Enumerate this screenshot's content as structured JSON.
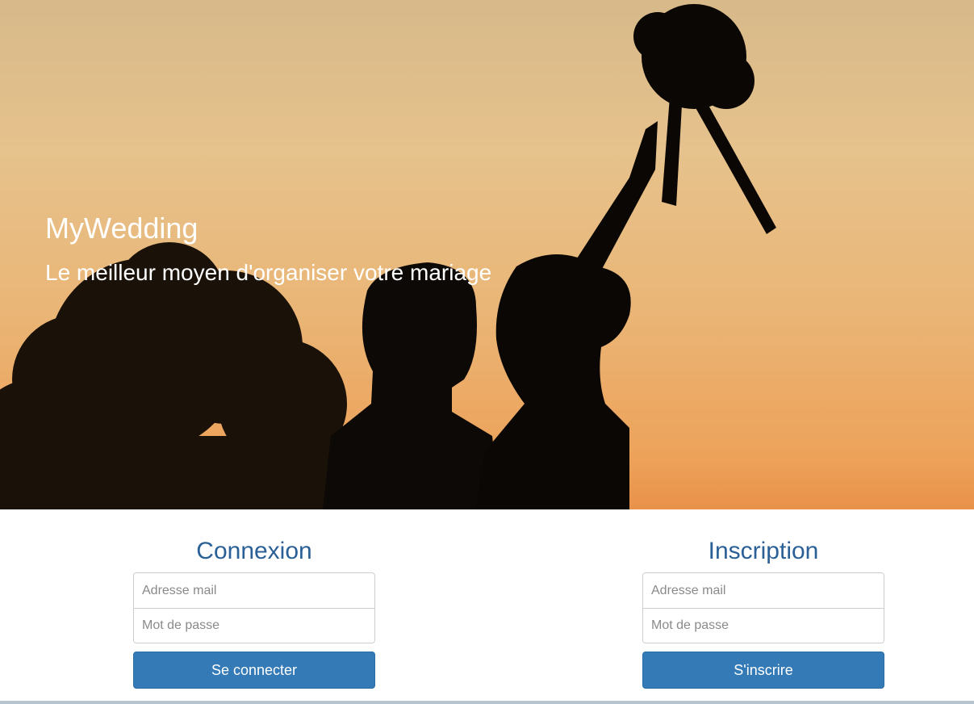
{
  "hero": {
    "title": "MyWedding",
    "tagline": "Le meilleur moyen d'organiser votre mariage"
  },
  "login": {
    "heading": "Connexion",
    "email_placeholder": "Adresse mail",
    "password_placeholder": "Mot de passe",
    "submit_label": "Se connecter"
  },
  "signup": {
    "heading": "Inscription",
    "email_placeholder": "Adresse mail",
    "password_placeholder": "Mot de passe",
    "submit_label": "S'inscrire"
  },
  "colors": {
    "primary": "#337ab7",
    "heading": "#2a6096",
    "sky_top": "#d7b98a",
    "sky_bottom": "#e9914a"
  }
}
